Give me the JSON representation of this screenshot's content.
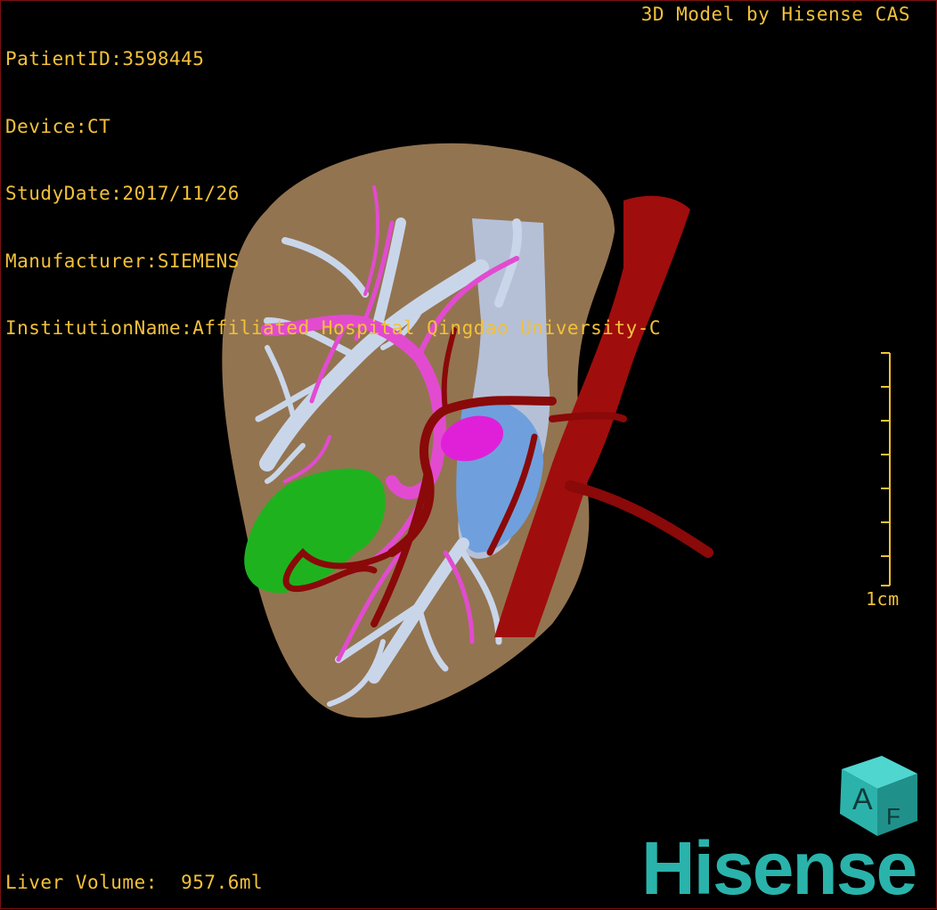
{
  "overlay": {
    "patient_id": "PatientID:3598445",
    "device": "Device:CT",
    "study_date": "StudyDate:2017/11/26",
    "manufacturer": "Manufacturer:SIEMENS",
    "institution": "InstitutionName:Affiliated Hospital Qingdao University-C",
    "vendor": "3D Model by Hisense CAS",
    "liver_volume": "Liver Volume:  957.6ml",
    "scale_unit": "1cm"
  },
  "logo": {
    "brand": "Hisense",
    "cube_letters": [
      "A",
      "F"
    ],
    "brand_color": "#2ab3ab"
  },
  "colors": {
    "overlay_text": "#f2c13a",
    "liver": "#9b7a54",
    "hepatic_vein": "#c9d6ea",
    "portal_vein": "#e24bd0",
    "artery_aorta": "#9a0a0a",
    "tumor": "#1fb21f",
    "ivc": "#6fa0dd"
  }
}
